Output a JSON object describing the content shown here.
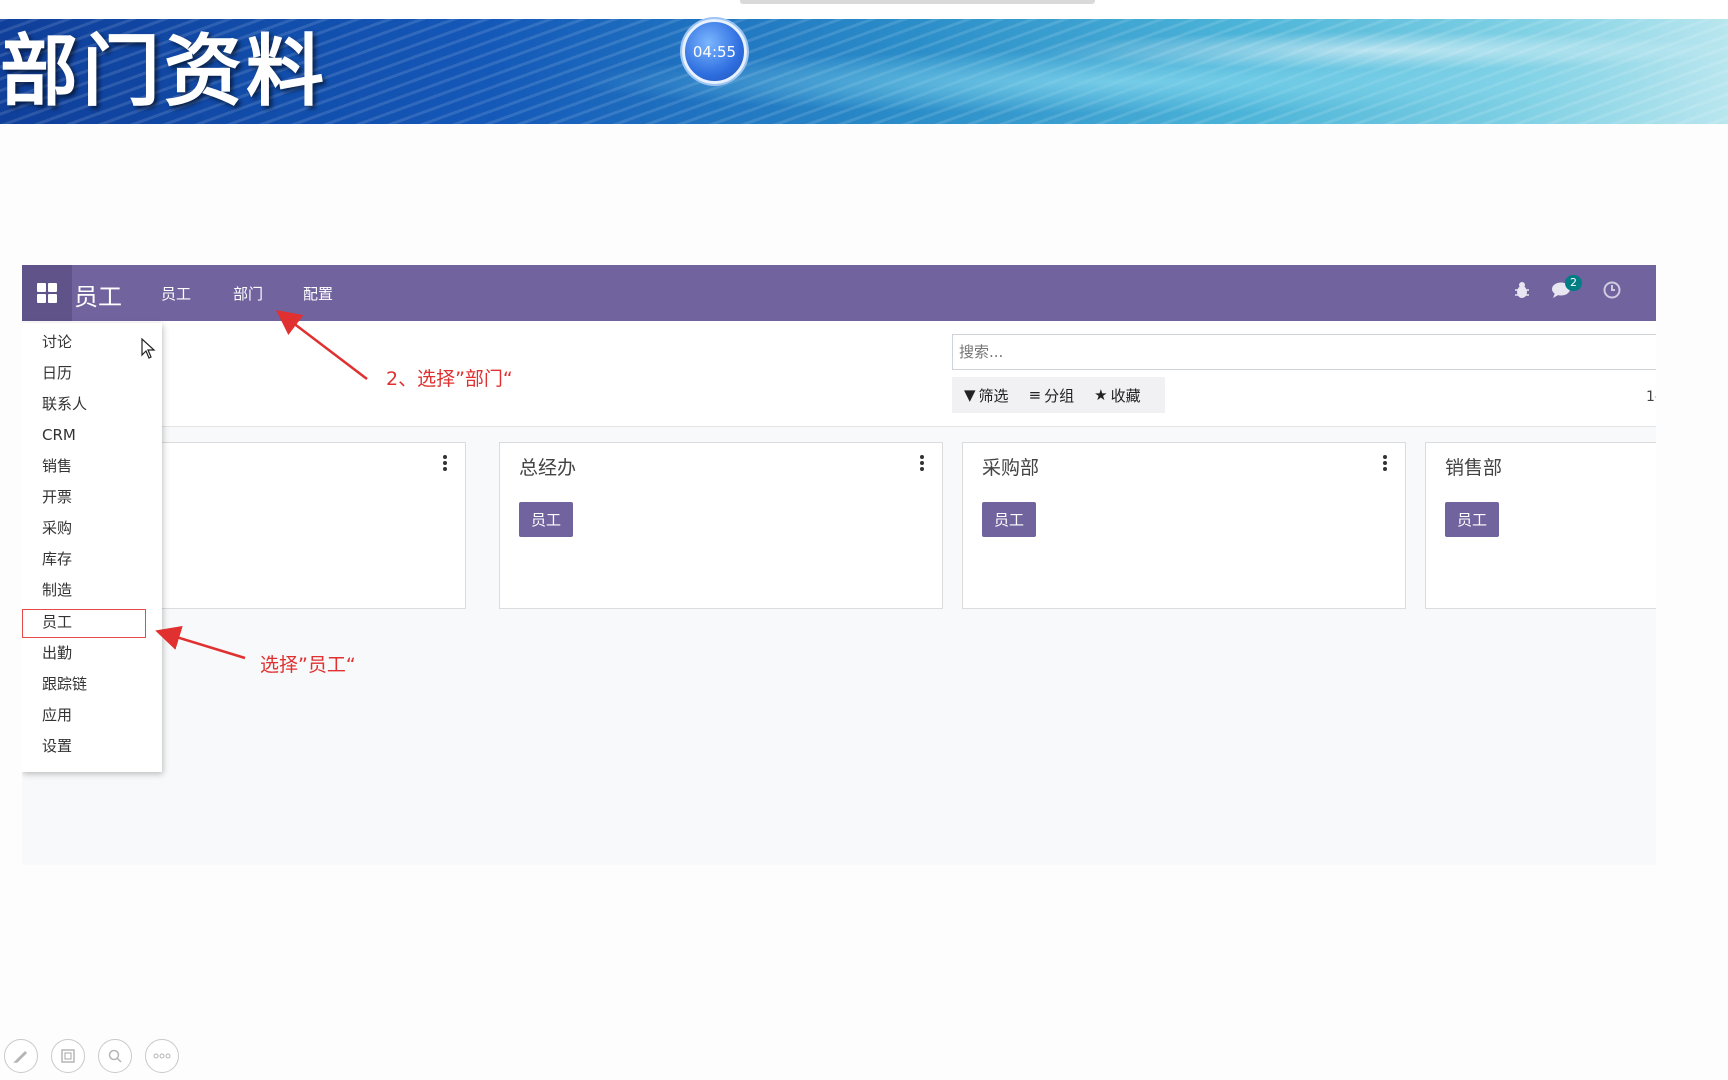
{
  "slide": {
    "title": "部门资料",
    "timer": "04:55"
  },
  "navbar": {
    "brand": "员工",
    "menu": [
      "员工",
      "部门",
      "配置"
    ],
    "message_count": "2"
  },
  "search": {
    "placeholder": "搜索..."
  },
  "filters": {
    "filter_label": "筛选",
    "group_label": "分组",
    "favorites_label": "收藏"
  },
  "pager": "1-",
  "app_menu": {
    "items": [
      "讨论",
      "日历",
      "联系人",
      "CRM",
      "销售",
      "开票",
      "采购",
      "库存",
      "制造",
      "员工",
      "出勤",
      "跟踪链",
      "应用",
      "设置"
    ],
    "highlighted": "员工"
  },
  "departments": [
    {
      "name": "",
      "button": ""
    },
    {
      "name": "总经办",
      "button": "员工"
    },
    {
      "name": "采购部",
      "button": "员工"
    },
    {
      "name": "销售部",
      "button": "员工"
    }
  ],
  "annotations": {
    "step2": "2、选择”部门“",
    "step1": "选择”员工“",
    "color": "#e03030"
  },
  "colors": {
    "primary": "#71639e",
    "badge": "#017e84"
  }
}
